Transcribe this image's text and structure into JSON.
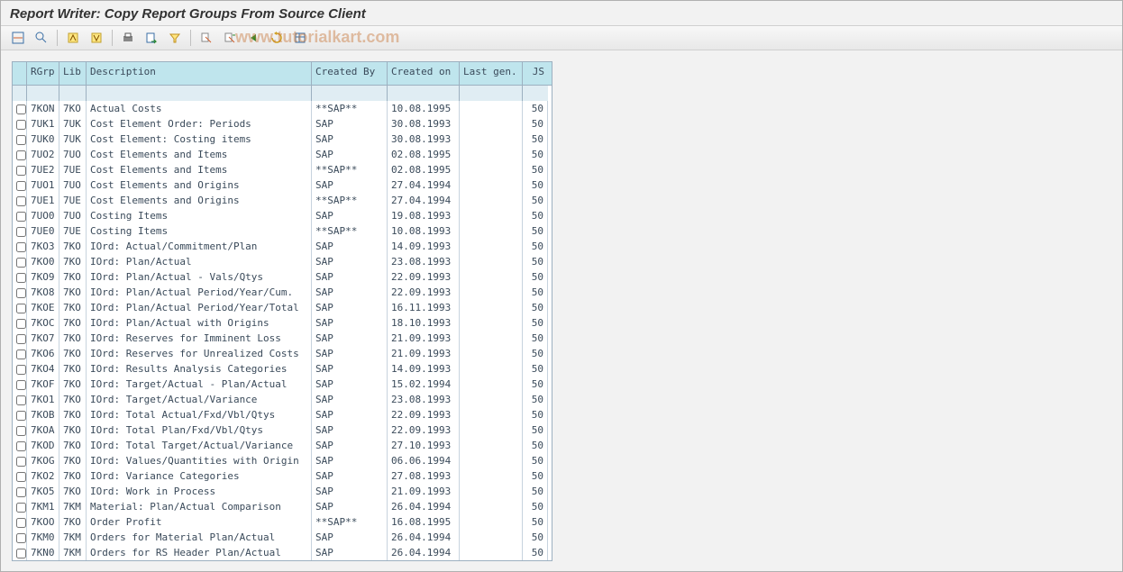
{
  "title": "Report Writer: Copy Report Groups From Source Client",
  "watermark": "www.tutorialkart.com",
  "toolbar": {
    "icons": [
      "deselect-all-icon",
      "details-icon",
      "sep",
      "sort-asc-icon",
      "sort-desc-icon",
      "sep",
      "print-icon",
      "export-icon",
      "filter-icon",
      "sep",
      "find-icon",
      "find-next-icon",
      "back-icon",
      "refresh-icon",
      "layout-icon"
    ]
  },
  "columns": {
    "rgrp": "RGrp",
    "lib": "Lib",
    "desc": "Description",
    "by": "Created By",
    "on": "Created on",
    "lg": "Last gen.",
    "js": "JS"
  },
  "rows": [
    {
      "rgrp": "7KON",
      "lib": "7KO",
      "desc": "Actual Costs",
      "by": "**SAP**",
      "on": "10.08.1995",
      "lg": "",
      "js": "50"
    },
    {
      "rgrp": "7UK1",
      "lib": "7UK",
      "desc": "Cost Element Order: Periods",
      "by": "SAP",
      "on": "30.08.1993",
      "lg": "",
      "js": "50"
    },
    {
      "rgrp": "7UK0",
      "lib": "7UK",
      "desc": "Cost Element: Costing items",
      "by": "SAP",
      "on": "30.08.1993",
      "lg": "",
      "js": "50"
    },
    {
      "rgrp": "7UO2",
      "lib": "7UO",
      "desc": "Cost Elements and Items",
      "by": "SAP",
      "on": "02.08.1995",
      "lg": "",
      "js": "50"
    },
    {
      "rgrp": "7UE2",
      "lib": "7UE",
      "desc": "Cost Elements and Items",
      "by": "**SAP**",
      "on": "02.08.1995",
      "lg": "",
      "js": "50"
    },
    {
      "rgrp": "7UO1",
      "lib": "7UO",
      "desc": "Cost Elements and Origins",
      "by": "SAP",
      "on": "27.04.1994",
      "lg": "",
      "js": "50"
    },
    {
      "rgrp": "7UE1",
      "lib": "7UE",
      "desc": "Cost Elements and Origins",
      "by": "**SAP**",
      "on": "27.04.1994",
      "lg": "",
      "js": "50"
    },
    {
      "rgrp": "7UO0",
      "lib": "7UO",
      "desc": "Costing Items",
      "by": "SAP",
      "on": "19.08.1993",
      "lg": "",
      "js": "50"
    },
    {
      "rgrp": "7UE0",
      "lib": "7UE",
      "desc": "Costing Items",
      "by": "**SAP**",
      "on": "10.08.1993",
      "lg": "",
      "js": "50"
    },
    {
      "rgrp": "7KO3",
      "lib": "7KO",
      "desc": "IOrd: Actual/Commitment/Plan",
      "by": "SAP",
      "on": "14.09.1993",
      "lg": "",
      "js": "50"
    },
    {
      "rgrp": "7KO0",
      "lib": "7KO",
      "desc": "IOrd: Plan/Actual",
      "by": "SAP",
      "on": "23.08.1993",
      "lg": "",
      "js": "50"
    },
    {
      "rgrp": "7KO9",
      "lib": "7KO",
      "desc": "IOrd: Plan/Actual - Vals/Qtys",
      "by": "SAP",
      "on": "22.09.1993",
      "lg": "",
      "js": "50"
    },
    {
      "rgrp": "7KO8",
      "lib": "7KO",
      "desc": "IOrd: Plan/Actual Period/Year/Cum.",
      "by": "SAP",
      "on": "22.09.1993",
      "lg": "",
      "js": "50"
    },
    {
      "rgrp": "7KOE",
      "lib": "7KO",
      "desc": "IOrd: Plan/Actual Period/Year/Total",
      "by": "SAP",
      "on": "16.11.1993",
      "lg": "",
      "js": "50"
    },
    {
      "rgrp": "7KOC",
      "lib": "7KO",
      "desc": "IOrd: Plan/Actual with Origins",
      "by": "SAP",
      "on": "18.10.1993",
      "lg": "",
      "js": "50"
    },
    {
      "rgrp": "7KO7",
      "lib": "7KO",
      "desc": "IOrd: Reserves for Imminent Loss",
      "by": "SAP",
      "on": "21.09.1993",
      "lg": "",
      "js": "50"
    },
    {
      "rgrp": "7KO6",
      "lib": "7KO",
      "desc": "IOrd: Reserves for Unrealized Costs",
      "by": "SAP",
      "on": "21.09.1993",
      "lg": "",
      "js": "50"
    },
    {
      "rgrp": "7KO4",
      "lib": "7KO",
      "desc": "IOrd: Results Analysis Categories",
      "by": "SAP",
      "on": "14.09.1993",
      "lg": "",
      "js": "50"
    },
    {
      "rgrp": "7KOF",
      "lib": "7KO",
      "desc": "IOrd: Target/Actual - Plan/Actual",
      "by": "SAP",
      "on": "15.02.1994",
      "lg": "",
      "js": "50"
    },
    {
      "rgrp": "7KO1",
      "lib": "7KO",
      "desc": "IOrd: Target/Actual/Variance",
      "by": "SAP",
      "on": "23.08.1993",
      "lg": "",
      "js": "50"
    },
    {
      "rgrp": "7KOB",
      "lib": "7KO",
      "desc": "IOrd: Total Actual/Fxd/Vbl/Qtys",
      "by": "SAP",
      "on": "22.09.1993",
      "lg": "",
      "js": "50"
    },
    {
      "rgrp": "7KOA",
      "lib": "7KO",
      "desc": "IOrd: Total Plan/Fxd/Vbl/Qtys",
      "by": "SAP",
      "on": "22.09.1993",
      "lg": "",
      "js": "50"
    },
    {
      "rgrp": "7KOD",
      "lib": "7KO",
      "desc": "IOrd: Total Target/Actual/Variance",
      "by": "SAP",
      "on": "27.10.1993",
      "lg": "",
      "js": "50"
    },
    {
      "rgrp": "7KOG",
      "lib": "7KO",
      "desc": "IOrd: Values/Quantities with Origin",
      "by": "SAP",
      "on": "06.06.1994",
      "lg": "",
      "js": "50"
    },
    {
      "rgrp": "7KO2",
      "lib": "7KO",
      "desc": "IOrd: Variance Categories",
      "by": "SAP",
      "on": "27.08.1993",
      "lg": "",
      "js": "50"
    },
    {
      "rgrp": "7KO5",
      "lib": "7KO",
      "desc": "IOrd: Work in Process",
      "by": "SAP",
      "on": "21.09.1993",
      "lg": "",
      "js": "50"
    },
    {
      "rgrp": "7KM1",
      "lib": "7KM",
      "desc": "Material: Plan/Actual Comparison",
      "by": "SAP",
      "on": "26.04.1994",
      "lg": "",
      "js": "50"
    },
    {
      "rgrp": "7KOO",
      "lib": "7KO",
      "desc": "Order Profit",
      "by": "**SAP**",
      "on": "16.08.1995",
      "lg": "",
      "js": "50"
    },
    {
      "rgrp": "7KM0",
      "lib": "7KM",
      "desc": "Orders for Material Plan/Actual",
      "by": "SAP",
      "on": "26.04.1994",
      "lg": "",
      "js": "50"
    },
    {
      "rgrp": "7KN0",
      "lib": "7KM",
      "desc": "Orders for RS Header Plan/Actual",
      "by": "SAP",
      "on": "26.04.1994",
      "lg": "",
      "js": "50"
    }
  ]
}
